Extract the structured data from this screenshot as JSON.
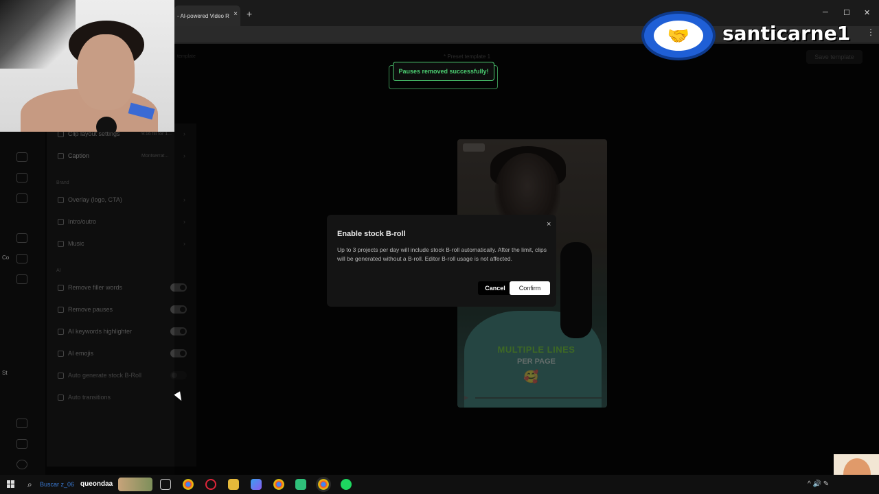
{
  "browser": {
    "tab_title": "- AI-powered Video R",
    "tab_close": "×",
    "new_tab": "+",
    "minimize": "─",
    "maximize": "☐",
    "close": "✕"
  },
  "toolbar": {
    "breadcrumb": "template",
    "title": "* Preset template 1",
    "save_label": "Save template"
  },
  "toast": {
    "message": "Pauses removed successfully!",
    "color": "#4ccf72"
  },
  "sidebar": {
    "items": [
      {
        "label": "Clip layout settings",
        "value": "9:16 fill for 1..."
      },
      {
        "label": "Caption",
        "value": "Montserrat..."
      }
    ],
    "brand_section": "Brand",
    "brand_items": [
      {
        "label": "Overlay (logo, CTA)"
      },
      {
        "label": "Intro/outro"
      },
      {
        "label": "Music"
      }
    ],
    "ai_section": "AI",
    "ai_items": [
      {
        "label": "Remove filler words",
        "on": true
      },
      {
        "label": "Remove pauses",
        "on": true
      },
      {
        "label": "AI keywords highlighter",
        "on": true
      },
      {
        "label": "AI emojis",
        "on": true
      },
      {
        "label": "Auto generate stock B-Roll",
        "on": false
      },
      {
        "label": "Auto transitions",
        "on": false
      }
    ],
    "chevron": "›"
  },
  "preview": {
    "caption_line1": "MULTIPLE LINES",
    "caption_line2": "PER PAGE",
    "emoji": "🥰",
    "play_icon": "▶"
  },
  "dialog": {
    "title": "Enable stock B-roll",
    "body": "Up to 3 projects per day will include stock B-roll automatically. After the limit, clips will be generated without a B-roll. Editor B-roll usage is not affected.",
    "close": "×",
    "cancel_label": "Cancel",
    "confirm_label": "Confirm"
  },
  "overlay": {
    "streamer_name": "santicarne1",
    "logo_icon": "🤝"
  },
  "left_peek": {
    "line1": "Co",
    "line2": "St"
  },
  "taskbar": {
    "search_glyph": "⌕",
    "search_hint": "Buscar",
    "search_user": "z_06",
    "search_word": "queondaa",
    "tray_chevron": "^",
    "tray_speaker": "🔊",
    "tray_pen": "✎"
  }
}
